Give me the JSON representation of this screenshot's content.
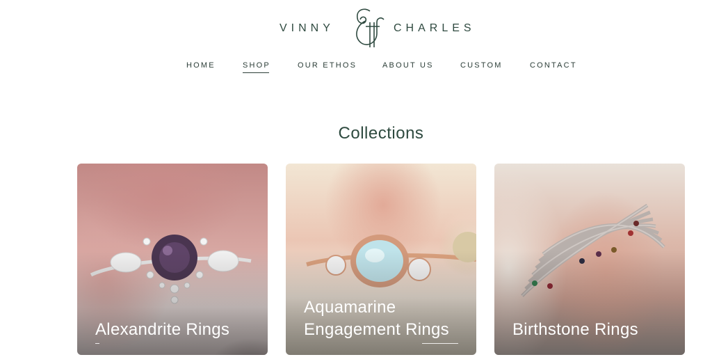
{
  "brand": {
    "left_word": "VINNY",
    "right_word": "CHARLES",
    "mark_icon": "ampersand-monogram-icon",
    "color": "#2f4a40"
  },
  "nav": {
    "items": [
      {
        "label": "HOME",
        "active": false
      },
      {
        "label": "SHOP",
        "active": true
      },
      {
        "label": "OUR ETHOS",
        "active": false
      },
      {
        "label": "ABOUT US",
        "active": false
      },
      {
        "label": "CUSTOM",
        "active": false
      },
      {
        "label": "CONTACT",
        "active": false
      }
    ]
  },
  "collections": {
    "title": "Collections",
    "cards": [
      {
        "title": "Alexandrite Rings",
        "image": "alexandrite-ring-photo"
      },
      {
        "title": "Aquamarine Engagement Rings",
        "image": "aquamarine-ring-photo"
      },
      {
        "title": "Birthstone Rings",
        "image": "birthstone-stack-rings-photo"
      }
    ]
  }
}
